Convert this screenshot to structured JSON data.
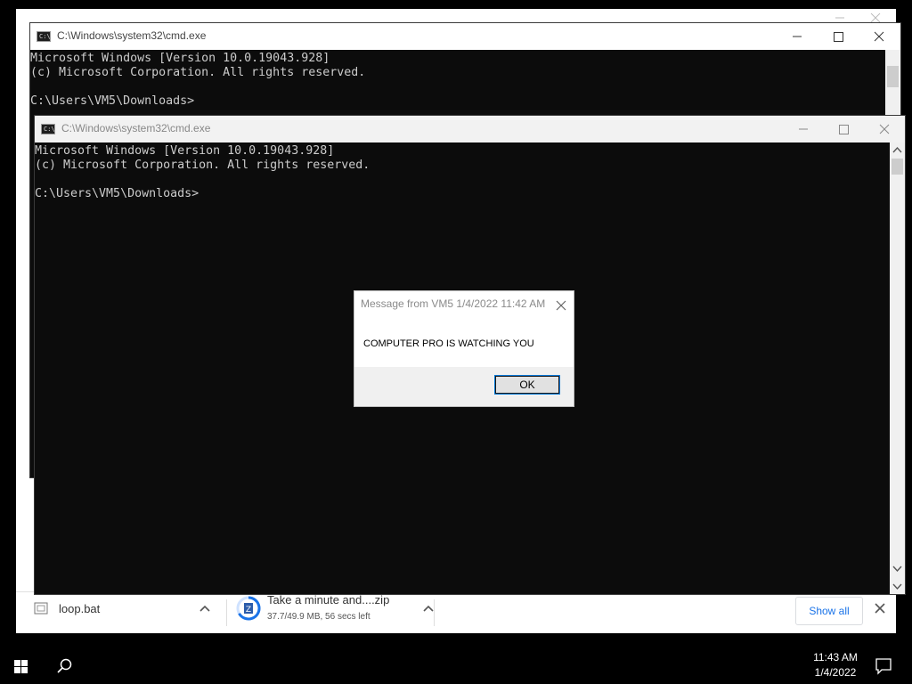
{
  "console_back": {
    "title": "C:\\Windows\\system32\\cmd.exe",
    "lines": "Microsoft Windows [Version 10.0.19043.928]\n(c) Microsoft Corporation. All rights reserved.\n\nC:\\Users\\VM5\\Downloads>"
  },
  "console_front": {
    "title": "C:\\Windows\\system32\\cmd.exe",
    "lines": "Microsoft Windows [Version 10.0.19043.928]\n(c) Microsoft Corporation. All rights reserved.\n\nC:\\Users\\VM5\\Downloads>"
  },
  "dialog": {
    "title": "Message from VM5 1/4/2022 11:42 AM",
    "message": "COMPUTER PRO IS WATCHING YOU",
    "ok_label": "OK"
  },
  "downloads": {
    "items": [
      {
        "name": "loop.bat",
        "status": ""
      },
      {
        "name": "Take a minute and....zip",
        "status": "37.7/49.9 MB, 56 secs left"
      }
    ],
    "show_all_label": "Show all"
  },
  "taskbar": {
    "time": "11:43 AM",
    "date": "1/4/2022"
  }
}
